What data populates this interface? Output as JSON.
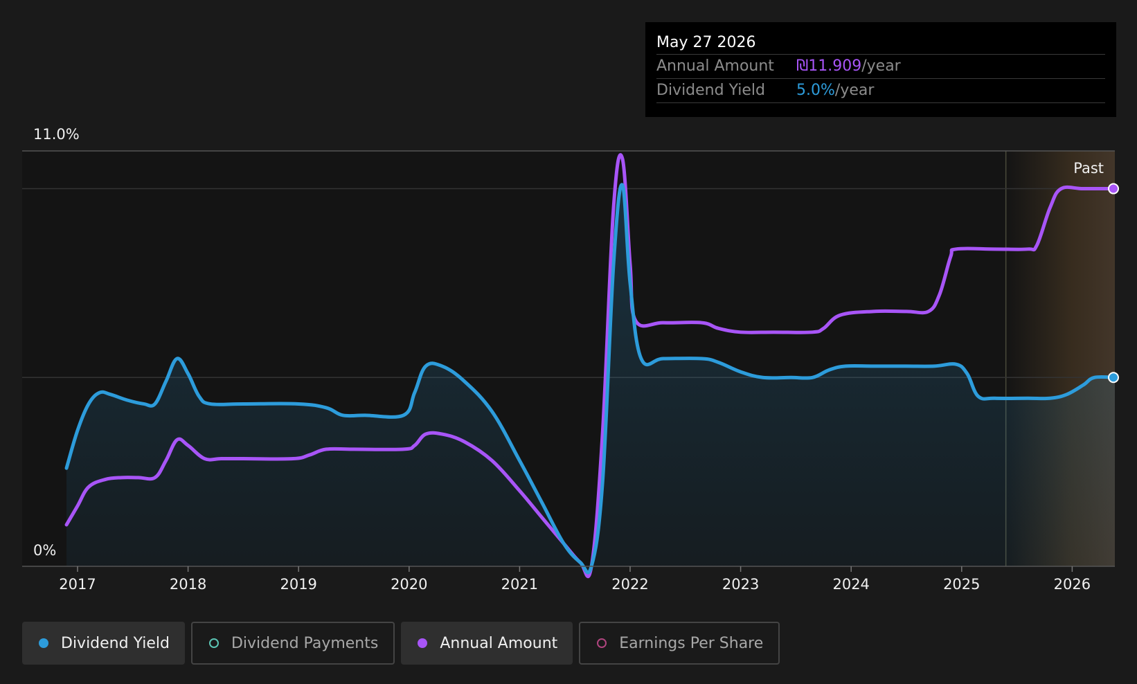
{
  "tooltip": {
    "date": "May 27 2026",
    "rows": [
      {
        "label": "Annual Amount",
        "value": "₪11.909",
        "unit": "/year",
        "color": "#a855f7"
      },
      {
        "label": "Dividend Yield",
        "value": "5.0%",
        "unit": "/year",
        "color": "#2d9cdb"
      }
    ]
  },
  "legend": [
    {
      "label": "Dividend Yield",
      "color": "#2d9cdb",
      "active": true
    },
    {
      "label": "Dividend Payments",
      "color": "#5cc6b5",
      "active": false
    },
    {
      "label": "Annual Amount",
      "color": "#a855f7",
      "active": true
    },
    {
      "label": "Earnings Per Share",
      "color": "#b0457f",
      "active": false
    }
  ],
  "chart_data": {
    "type": "line",
    "x_ticks": [
      2017,
      2018,
      2019,
      2020,
      2021,
      2022,
      2023,
      2024,
      2025,
      2026
    ],
    "xlim": [
      2016.5,
      2026.4
    ],
    "ylim": [
      0,
      11.0
    ],
    "y_tick_labels": {
      "top": "11.0%",
      "bottom": "0%"
    },
    "past_label": "Past",
    "past_region_start": 2025.4,
    "series": [
      {
        "name": "Dividend Yield",
        "color": "#2d9cdb",
        "area": true,
        "points": [
          [
            2016.9,
            2.6
          ],
          [
            2017.0,
            3.6
          ],
          [
            2017.1,
            4.3
          ],
          [
            2017.2,
            4.6
          ],
          [
            2017.3,
            4.55
          ],
          [
            2017.45,
            4.4
          ],
          [
            2017.6,
            4.3
          ],
          [
            2017.7,
            4.3
          ],
          [
            2017.8,
            4.9
          ],
          [
            2017.9,
            5.5
          ],
          [
            2018.0,
            5.1
          ],
          [
            2018.1,
            4.5
          ],
          [
            2018.2,
            4.3
          ],
          [
            2018.5,
            4.3
          ],
          [
            2019.0,
            4.3
          ],
          [
            2019.25,
            4.2
          ],
          [
            2019.4,
            4.0
          ],
          [
            2019.6,
            4.0
          ],
          [
            2019.95,
            4.0
          ],
          [
            2020.05,
            4.6
          ],
          [
            2020.15,
            5.3
          ],
          [
            2020.3,
            5.3
          ],
          [
            2020.5,
            4.9
          ],
          [
            2020.75,
            4.1
          ],
          [
            2021.0,
            2.8
          ],
          [
            2021.2,
            1.7
          ],
          [
            2021.4,
            0.6
          ],
          [
            2021.55,
            0.1
          ],
          [
            2021.65,
            0.0
          ],
          [
            2021.75,
            2.2
          ],
          [
            2021.85,
            8.0
          ],
          [
            2021.93,
            10.1
          ],
          [
            2022.0,
            7.5
          ],
          [
            2022.1,
            5.5
          ],
          [
            2022.3,
            5.5
          ],
          [
            2022.65,
            5.5
          ],
          [
            2022.8,
            5.4
          ],
          [
            2023.0,
            5.15
          ],
          [
            2023.2,
            5.0
          ],
          [
            2023.45,
            5.0
          ],
          [
            2023.65,
            5.0
          ],
          [
            2023.8,
            5.2
          ],
          [
            2023.95,
            5.3
          ],
          [
            2024.2,
            5.3
          ],
          [
            2024.5,
            5.3
          ],
          [
            2024.75,
            5.3
          ],
          [
            2024.95,
            5.35
          ],
          [
            2025.05,
            5.1
          ],
          [
            2025.15,
            4.5
          ],
          [
            2025.3,
            4.45
          ],
          [
            2025.6,
            4.45
          ],
          [
            2025.8,
            4.45
          ],
          [
            2025.95,
            4.55
          ],
          [
            2026.1,
            4.8
          ],
          [
            2026.2,
            5.0
          ],
          [
            2026.4,
            5.0
          ]
        ]
      },
      {
        "name": "Annual Amount",
        "color": "#a855f7",
        "area": false,
        "points": [
          [
            2016.9,
            1.1
          ],
          [
            2017.0,
            1.6
          ],
          [
            2017.1,
            2.1
          ],
          [
            2017.25,
            2.3
          ],
          [
            2017.4,
            2.35
          ],
          [
            2017.55,
            2.35
          ],
          [
            2017.7,
            2.35
          ],
          [
            2017.8,
            2.8
          ],
          [
            2017.9,
            3.35
          ],
          [
            2018.0,
            3.2
          ],
          [
            2018.15,
            2.85
          ],
          [
            2018.3,
            2.85
          ],
          [
            2018.5,
            2.85
          ],
          [
            2018.95,
            2.85
          ],
          [
            2019.1,
            2.95
          ],
          [
            2019.25,
            3.1
          ],
          [
            2019.5,
            3.1
          ],
          [
            2019.95,
            3.1
          ],
          [
            2020.05,
            3.2
          ],
          [
            2020.15,
            3.5
          ],
          [
            2020.3,
            3.5
          ],
          [
            2020.5,
            3.3
          ],
          [
            2020.75,
            2.8
          ],
          [
            2021.0,
            2.0
          ],
          [
            2021.2,
            1.3
          ],
          [
            2021.4,
            0.6
          ],
          [
            2021.55,
            0.1
          ],
          [
            2021.65,
            0.0
          ],
          [
            2021.75,
            3.5
          ],
          [
            2021.85,
            9.5
          ],
          [
            2021.93,
            10.8
          ],
          [
            2022.0,
            8.0
          ],
          [
            2022.05,
            6.5
          ],
          [
            2022.3,
            6.45
          ],
          [
            2022.65,
            6.45
          ],
          [
            2022.8,
            6.3
          ],
          [
            2023.0,
            6.2
          ],
          [
            2023.3,
            6.2
          ],
          [
            2023.65,
            6.2
          ],
          [
            2023.75,
            6.3
          ],
          [
            2023.9,
            6.65
          ],
          [
            2024.2,
            6.75
          ],
          [
            2024.5,
            6.75
          ],
          [
            2024.7,
            6.75
          ],
          [
            2024.8,
            7.2
          ],
          [
            2024.9,
            8.2
          ],
          [
            2024.95,
            8.4
          ],
          [
            2025.3,
            8.4
          ],
          [
            2025.6,
            8.4
          ],
          [
            2025.68,
            8.5
          ],
          [
            2025.8,
            9.5
          ],
          [
            2025.9,
            10.0
          ],
          [
            2026.1,
            10.0
          ],
          [
            2026.4,
            10.0
          ]
        ]
      }
    ]
  }
}
